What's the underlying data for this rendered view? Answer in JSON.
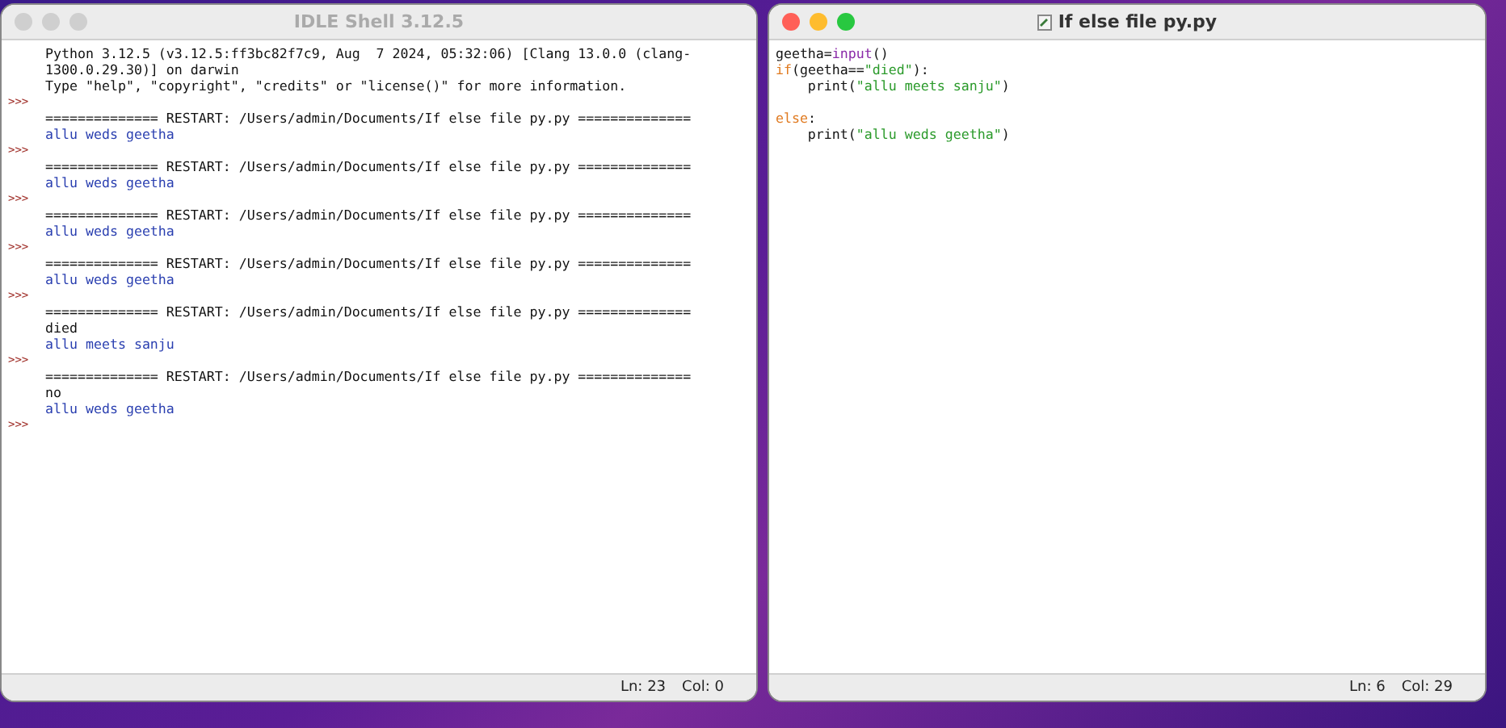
{
  "shell": {
    "title": "IDLE Shell 3.12.5",
    "active": false,
    "lines": [
      {
        "kind": "info",
        "text": "Python 3.12.5 (v3.12.5:ff3bc82f7c9, Aug  7 2024, 05:32:06) [Clang 13.0.0 (clang-"
      },
      {
        "kind": "info",
        "text": "1300.0.29.30)] on darwin"
      },
      {
        "kind": "info",
        "text": "Type \"help\", \"copyright\", \"credits\" or \"license()\" for more information."
      },
      {
        "kind": "prompt",
        "text": ">>>"
      },
      {
        "kind": "restart",
        "text": "============== RESTART: /Users/admin/Documents/If else file py.py =============="
      },
      {
        "kind": "output",
        "text": "allu weds geetha"
      },
      {
        "kind": "prompt",
        "text": ">>>"
      },
      {
        "kind": "restart",
        "text": "============== RESTART: /Users/admin/Documents/If else file py.py =============="
      },
      {
        "kind": "output",
        "text": "allu weds geetha"
      },
      {
        "kind": "prompt",
        "text": ">>>"
      },
      {
        "kind": "restart",
        "text": "============== RESTART: /Users/admin/Documents/If else file py.py =============="
      },
      {
        "kind": "output",
        "text": "allu weds geetha"
      },
      {
        "kind": "prompt",
        "text": ">>>"
      },
      {
        "kind": "restart",
        "text": "============== RESTART: /Users/admin/Documents/If else file py.py =============="
      },
      {
        "kind": "output",
        "text": "allu weds geetha"
      },
      {
        "kind": "prompt",
        "text": ">>>"
      },
      {
        "kind": "restart",
        "text": "============== RESTART: /Users/admin/Documents/If else file py.py =============="
      },
      {
        "kind": "input",
        "text": "died"
      },
      {
        "kind": "output",
        "text": "allu meets sanju"
      },
      {
        "kind": "prompt",
        "text": ">>>"
      },
      {
        "kind": "restart",
        "text": "============== RESTART: /Users/admin/Documents/If else file py.py =============="
      },
      {
        "kind": "input",
        "text": "no"
      },
      {
        "kind": "output",
        "text": "allu weds geetha"
      },
      {
        "kind": "prompt",
        "text": ">>>"
      }
    ],
    "status": {
      "line": "Ln: 23",
      "col": "Col: 0"
    }
  },
  "editor": {
    "title": "If else file py.py",
    "active": true,
    "lines": [
      {
        "kind": "code",
        "tokens": [
          {
            "kind": "plain",
            "text": "geetha="
          },
          {
            "kind": "builtin",
            "text": "input"
          },
          {
            "kind": "plain",
            "text": "()"
          }
        ]
      },
      {
        "kind": "code",
        "tokens": [
          {
            "kind": "keyword",
            "text": "if"
          },
          {
            "kind": "plain",
            "text": "(geetha=="
          },
          {
            "kind": "string",
            "text": "\"died\""
          },
          {
            "kind": "plain",
            "text": "):"
          }
        ]
      },
      {
        "kind": "code",
        "tokens": [
          {
            "kind": "plain",
            "text": "    print("
          },
          {
            "kind": "string",
            "text": "\"allu meets sanju\""
          },
          {
            "kind": "plain",
            "text": ")"
          }
        ]
      },
      {
        "kind": "blank"
      },
      {
        "kind": "code",
        "tokens": [
          {
            "kind": "keyword",
            "text": "else"
          },
          {
            "kind": "plain",
            "text": ":"
          }
        ]
      },
      {
        "kind": "code",
        "tokens": [
          {
            "kind": "plain",
            "text": "    print("
          },
          {
            "kind": "string",
            "text": "\"allu weds geetha\""
          },
          {
            "kind": "plain",
            "text": ")"
          }
        ]
      }
    ],
    "status": {
      "line": "Ln: 6",
      "col": "Col: 29"
    }
  }
}
